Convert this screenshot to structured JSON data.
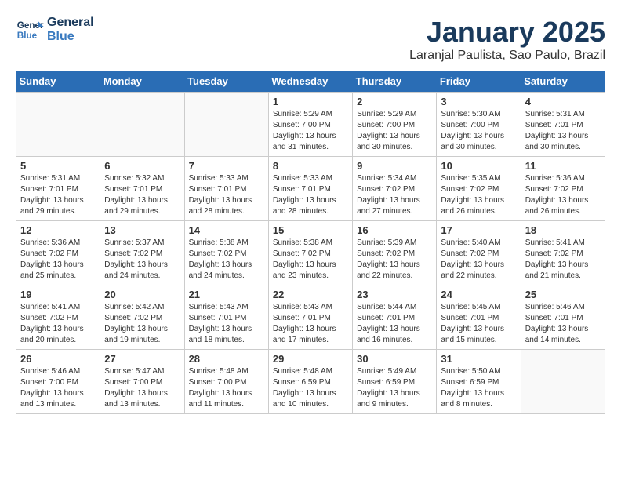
{
  "logo": {
    "text_general": "General",
    "text_blue": "Blue"
  },
  "header": {
    "month_title": "January 2025",
    "location": "Laranjal Paulista, Sao Paulo, Brazil"
  },
  "days_of_week": [
    "Sunday",
    "Monday",
    "Tuesday",
    "Wednesday",
    "Thursday",
    "Friday",
    "Saturday"
  ],
  "weeks": [
    {
      "days": [
        {
          "number": "",
          "info": ""
        },
        {
          "number": "",
          "info": ""
        },
        {
          "number": "",
          "info": ""
        },
        {
          "number": "1",
          "info": "Sunrise: 5:29 AM\nSunset: 7:00 PM\nDaylight: 13 hours\nand 31 minutes."
        },
        {
          "number": "2",
          "info": "Sunrise: 5:29 AM\nSunset: 7:00 PM\nDaylight: 13 hours\nand 30 minutes."
        },
        {
          "number": "3",
          "info": "Sunrise: 5:30 AM\nSunset: 7:00 PM\nDaylight: 13 hours\nand 30 minutes."
        },
        {
          "number": "4",
          "info": "Sunrise: 5:31 AM\nSunset: 7:01 PM\nDaylight: 13 hours\nand 30 minutes."
        }
      ]
    },
    {
      "days": [
        {
          "number": "5",
          "info": "Sunrise: 5:31 AM\nSunset: 7:01 PM\nDaylight: 13 hours\nand 29 minutes."
        },
        {
          "number": "6",
          "info": "Sunrise: 5:32 AM\nSunset: 7:01 PM\nDaylight: 13 hours\nand 29 minutes."
        },
        {
          "number": "7",
          "info": "Sunrise: 5:33 AM\nSunset: 7:01 PM\nDaylight: 13 hours\nand 28 minutes."
        },
        {
          "number": "8",
          "info": "Sunrise: 5:33 AM\nSunset: 7:01 PM\nDaylight: 13 hours\nand 28 minutes."
        },
        {
          "number": "9",
          "info": "Sunrise: 5:34 AM\nSunset: 7:02 PM\nDaylight: 13 hours\nand 27 minutes."
        },
        {
          "number": "10",
          "info": "Sunrise: 5:35 AM\nSunset: 7:02 PM\nDaylight: 13 hours\nand 26 minutes."
        },
        {
          "number": "11",
          "info": "Sunrise: 5:36 AM\nSunset: 7:02 PM\nDaylight: 13 hours\nand 26 minutes."
        }
      ]
    },
    {
      "days": [
        {
          "number": "12",
          "info": "Sunrise: 5:36 AM\nSunset: 7:02 PM\nDaylight: 13 hours\nand 25 minutes."
        },
        {
          "number": "13",
          "info": "Sunrise: 5:37 AM\nSunset: 7:02 PM\nDaylight: 13 hours\nand 24 minutes."
        },
        {
          "number": "14",
          "info": "Sunrise: 5:38 AM\nSunset: 7:02 PM\nDaylight: 13 hours\nand 24 minutes."
        },
        {
          "number": "15",
          "info": "Sunrise: 5:38 AM\nSunset: 7:02 PM\nDaylight: 13 hours\nand 23 minutes."
        },
        {
          "number": "16",
          "info": "Sunrise: 5:39 AM\nSunset: 7:02 PM\nDaylight: 13 hours\nand 22 minutes."
        },
        {
          "number": "17",
          "info": "Sunrise: 5:40 AM\nSunset: 7:02 PM\nDaylight: 13 hours\nand 22 minutes."
        },
        {
          "number": "18",
          "info": "Sunrise: 5:41 AM\nSunset: 7:02 PM\nDaylight: 13 hours\nand 21 minutes."
        }
      ]
    },
    {
      "days": [
        {
          "number": "19",
          "info": "Sunrise: 5:41 AM\nSunset: 7:02 PM\nDaylight: 13 hours\nand 20 minutes."
        },
        {
          "number": "20",
          "info": "Sunrise: 5:42 AM\nSunset: 7:02 PM\nDaylight: 13 hours\nand 19 minutes."
        },
        {
          "number": "21",
          "info": "Sunrise: 5:43 AM\nSunset: 7:01 PM\nDaylight: 13 hours\nand 18 minutes."
        },
        {
          "number": "22",
          "info": "Sunrise: 5:43 AM\nSunset: 7:01 PM\nDaylight: 13 hours\nand 17 minutes."
        },
        {
          "number": "23",
          "info": "Sunrise: 5:44 AM\nSunset: 7:01 PM\nDaylight: 13 hours\nand 16 minutes."
        },
        {
          "number": "24",
          "info": "Sunrise: 5:45 AM\nSunset: 7:01 PM\nDaylight: 13 hours\nand 15 minutes."
        },
        {
          "number": "25",
          "info": "Sunrise: 5:46 AM\nSunset: 7:01 PM\nDaylight: 13 hours\nand 14 minutes."
        }
      ]
    },
    {
      "days": [
        {
          "number": "26",
          "info": "Sunrise: 5:46 AM\nSunset: 7:00 PM\nDaylight: 13 hours\nand 13 minutes."
        },
        {
          "number": "27",
          "info": "Sunrise: 5:47 AM\nSunset: 7:00 PM\nDaylight: 13 hours\nand 13 minutes."
        },
        {
          "number": "28",
          "info": "Sunrise: 5:48 AM\nSunset: 7:00 PM\nDaylight: 13 hours\nand 11 minutes."
        },
        {
          "number": "29",
          "info": "Sunrise: 5:48 AM\nSunset: 6:59 PM\nDaylight: 13 hours\nand 10 minutes."
        },
        {
          "number": "30",
          "info": "Sunrise: 5:49 AM\nSunset: 6:59 PM\nDaylight: 13 hours\nand 9 minutes."
        },
        {
          "number": "31",
          "info": "Sunrise: 5:50 AM\nSunset: 6:59 PM\nDaylight: 13 hours\nand 8 minutes."
        },
        {
          "number": "",
          "info": ""
        }
      ]
    }
  ]
}
